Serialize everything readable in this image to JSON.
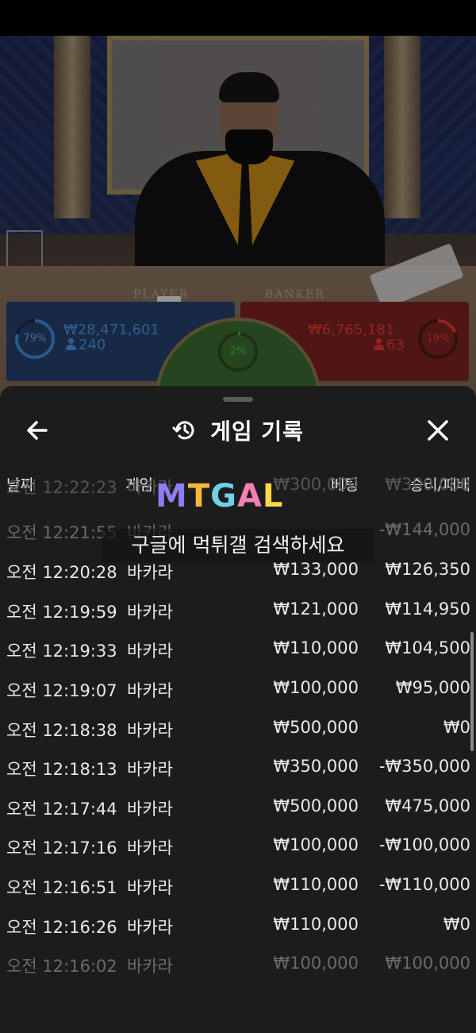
{
  "video": {
    "table_labels": {
      "player": "PLAYER",
      "banker": "BANKER"
    }
  },
  "betting": {
    "player": {
      "percent": "79%",
      "amount": "₩28,471,601",
      "players": "240",
      "percent_value": 79,
      "color": "#3d8be0"
    },
    "tie": {
      "percent": "2%",
      "percent_value": 2,
      "color": "#3fbf4a"
    },
    "banker": {
      "percent": "19%",
      "amount": "₩6,765,181",
      "players": "63",
      "percent_value": 19,
      "color": "#e03a32"
    }
  },
  "sheet": {
    "title": "게임 기록",
    "icons": {
      "back": "back-arrow-icon",
      "history": "history-icon",
      "close": "close-icon"
    },
    "columns": {
      "date": "날짜",
      "game": "게임",
      "bet": "베팅",
      "result": "승리/패배"
    },
    "rows": [
      {
        "date": "오전 12:22:23",
        "game": "바카라",
        "bet": "₩300,000",
        "result": "₩300,000"
      },
      {
        "date": "오전 12:21:55",
        "game": "바카라",
        "bet": "",
        "result": "-₩144,000"
      },
      {
        "date": "오전 12:20:28",
        "game": "바카라",
        "bet": "₩133,000",
        "result": "₩126,350"
      },
      {
        "date": "오전 12:19:59",
        "game": "바카라",
        "bet": "₩121,000",
        "result": "₩114,950"
      },
      {
        "date": "오전 12:19:33",
        "game": "바카라",
        "bet": "₩110,000",
        "result": "₩104,500"
      },
      {
        "date": "오전 12:19:07",
        "game": "바카라",
        "bet": "₩100,000",
        "result": "₩95,000"
      },
      {
        "date": "오전 12:18:38",
        "game": "바카라",
        "bet": "₩500,000",
        "result": "₩0"
      },
      {
        "date": "오전 12:18:13",
        "game": "바카라",
        "bet": "₩350,000",
        "result": "-₩350,000"
      },
      {
        "date": "오전 12:17:44",
        "game": "바카라",
        "bet": "₩500,000",
        "result": "₩475,000"
      },
      {
        "date": "오전 12:17:16",
        "game": "바카라",
        "bet": "₩100,000",
        "result": "-₩100,000"
      },
      {
        "date": "오전 12:16:51",
        "game": "바카라",
        "bet": "₩110,000",
        "result": "-₩110,000"
      },
      {
        "date": "오전 12:16:26",
        "game": "바카라",
        "bet": "₩110,000",
        "result": "₩0"
      },
      {
        "date": "오전 12:16:02",
        "game": "바카라",
        "bet": "₩100,000",
        "result": "₩100,000"
      }
    ]
  },
  "watermark": {
    "logo": "MTGAL",
    "text": "구글에 먹튀갤 검색하세요",
    "logo_colors": [
      "#8e7cf0",
      "#f4b93a",
      "#6fd0e8",
      "#f47fb0",
      "#ffd84a"
    ]
  }
}
